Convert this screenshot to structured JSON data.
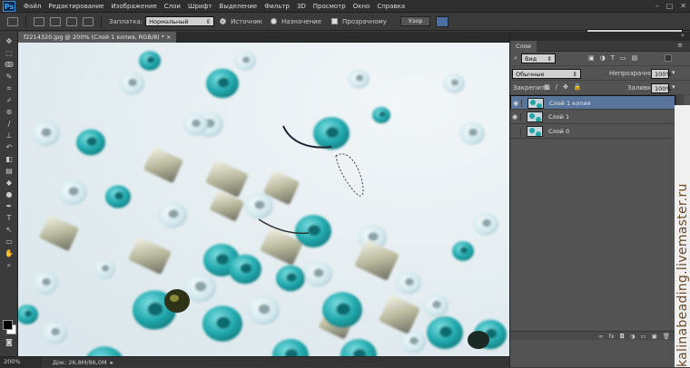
{
  "app": {
    "logo": "Ps"
  },
  "menu": [
    "Файл",
    "Редактирование",
    "Изображение",
    "Слои",
    "Шрифт",
    "Выделение",
    "Фильтр",
    "3D",
    "Просмотр",
    "Окно",
    "Справка"
  ],
  "window_controls": [
    "–",
    "□",
    "✕"
  ],
  "options": {
    "feather_label": "Заплатка:",
    "mode_value": "Нормальный",
    "source_label": "Источник",
    "destination_label": "Назначение",
    "transparent_label": "Прозрачному",
    "pattern_button": "Узор",
    "workspace": "Основная рабочая среда"
  },
  "document": {
    "tab_title": "f2214320.jpg @ 200% (Слой 1 копия, RGB/8) *",
    "close": "×"
  },
  "status": {
    "zoom": "200%",
    "doc": "Док: 26,8M/96,0M"
  },
  "layers_panel": {
    "tab": "Слои",
    "kind_value": "Вид",
    "blend_value": "Обычные",
    "opacity_label": "Непрозрачность:",
    "opacity_value": "100%",
    "lock_label": "Закрепить:",
    "fill_label": "Заливка:",
    "fill_value": "100%",
    "layers": [
      {
        "name": "Слой 1 копия",
        "selected": true,
        "visible": true
      },
      {
        "name": "Слой 1",
        "selected": false,
        "visible": true
      },
      {
        "name": "Слой 0",
        "selected": false,
        "visible": false
      }
    ],
    "bottom_icons": [
      "link-icon",
      "fx-icon",
      "mask-icon",
      "adjustment-icon",
      "folder-icon",
      "new-layer-icon",
      "trash-icon"
    ],
    "bottom_labels": [
      "∞",
      "fx",
      "◘",
      "◑",
      "▭",
      "▣",
      "🗑"
    ]
  },
  "watermark": "kalinabeading.livemaster.ru",
  "colors": {
    "teal": "#1fa7ab",
    "selection": "#59759c",
    "ui_dark": "#2f2f2f",
    "ui_panel": "#535353"
  }
}
